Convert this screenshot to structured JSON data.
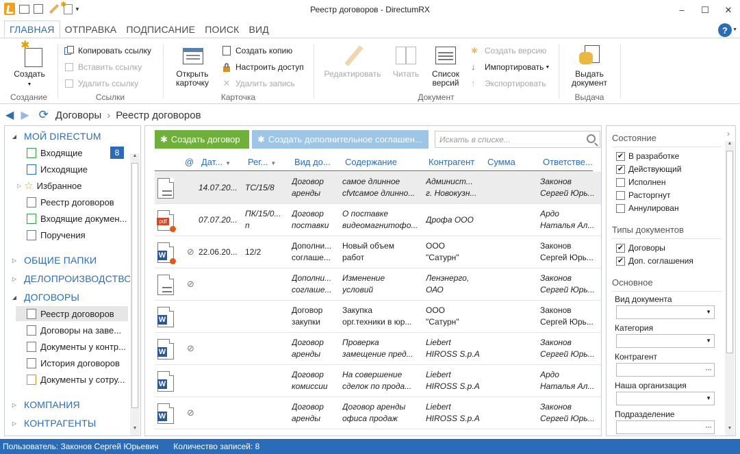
{
  "window": {
    "title": "Реестр договоров - DirectumRX",
    "controls": [
      "–",
      "☐",
      "✕"
    ]
  },
  "ribbon_tabs": [
    {
      "label": "ГЛАВНАЯ",
      "active": true
    },
    {
      "label": "ОТПРАВКА",
      "active": false
    },
    {
      "label": "ПОДПИСАНИЕ",
      "active": false
    },
    {
      "label": "ПОИСК",
      "active": false
    },
    {
      "label": "ВИД",
      "active": false
    }
  ],
  "ribbon": {
    "groups": {
      "create": "Создание",
      "links": "Ссылки",
      "card": "Карточка",
      "document": "Документ",
      "issue": "Выдача"
    },
    "create_button": "Создать",
    "copy_link": "Копировать ссылку",
    "paste_link": "Вставить ссылку",
    "delete_link": "Удалить ссылку",
    "open_card": "Открыть карточку",
    "create_copy": "Создать копию",
    "setup_access": "Настроить доступ",
    "delete_record": "Удалить запись",
    "edit": "Редактировать",
    "read": "Читать",
    "versions_list": "Список версий",
    "create_version": "Создать версию",
    "import": "Импортировать",
    "export": "Экспортировать",
    "issue_document": "Выдать документ"
  },
  "breadcrumb": [
    "Договоры",
    "Реестр договоров"
  ],
  "nav_tree": {
    "my_directum": "МОЙ DIRECTUM",
    "inbox": "Входящие",
    "inbox_count": "8",
    "outbox": "Исходящие",
    "favorites": "Избранное",
    "contracts_registry": "Реестр договоров",
    "incoming_docs": "Входящие докумен...",
    "assignments": "Поручения",
    "shared_folders": "ОБЩИЕ ПАПКИ",
    "records": "ДЕЛОПРОИЗВОДСТВО",
    "contracts": "ДОГОВОРЫ",
    "c_registry": "Реестр договоров",
    "c_approval": "Договоры на заве...",
    "c_control": "Документы у контр...",
    "c_history": "История договоров",
    "c_employees": "Документы у сотру...",
    "company": "КОМПАНИЯ",
    "counterparties": "КОНТРАГЕНТЫ"
  },
  "toolbar": {
    "create_contract": "Создать договор",
    "create_supplement": "Создать дополнительное соглашен...",
    "search_placeholder": "Искать в списке..."
  },
  "table": {
    "columns": [
      "@",
      "Дат...",
      "Рег...",
      "Вид до...",
      "Содержание",
      "Контрагент",
      "Сумма",
      "Ответстве..."
    ],
    "rows": [
      {
        "icon": "text",
        "clip": false,
        "date": "14.07.20...",
        "reg": "ТС/15/8",
        "kind1": "Договор",
        "kind2": "аренды",
        "content1": "самое длинное",
        "content2": "cfvtсамое длинно...",
        "cp1": "Админист...",
        "cp2": "г. Новокузн...",
        "amount": "",
        "resp1": "Законов",
        "resp2": "Сергей Юрь...",
        "italic": true,
        "selected": true
      },
      {
        "icon": "pdf",
        "clip": false,
        "date": "07.07.20...",
        "reg": "ПК/15/0...",
        "reg2": "n",
        "kind1": "Договор",
        "kind2": "поставки",
        "content1": "О поставке",
        "content2": "видеомагнитофо...",
        "cp1": "Дрофа ООО",
        "cp2": "",
        "amount": "",
        "resp1": "Ардо",
        "resp2": "Наталья Ал...",
        "italic": true,
        "selected": false
      },
      {
        "icon": "word-mark",
        "clip": true,
        "date": "22.06.20...",
        "reg": "12/2",
        "kind1": "Дополни...",
        "kind2": "соглаше...",
        "content1": "Новый объем",
        "content2": "работ",
        "cp1": "ООО",
        "cp2": "\"Сатурн\"",
        "amount": "",
        "resp1": "Законов",
        "resp2": "Сергей Юрь...",
        "italic": false,
        "selected": false
      },
      {
        "icon": "text",
        "clip": true,
        "date": "",
        "reg": "",
        "kind1": "Дополни...",
        "kind2": "соглаше...",
        "content1": "Изменение",
        "content2": "условий",
        "cp1": "Ленэнерго,",
        "cp2": "ОАО",
        "amount": "",
        "resp1": "Законов",
        "resp2": "Сергей Юрь...",
        "italic": true,
        "selected": false
      },
      {
        "icon": "word",
        "clip": false,
        "date": "",
        "reg": "",
        "kind1": "Договор",
        "kind2": "закупки",
        "content1": "Закупка",
        "content2": "орг.техники в юр...",
        "cp1": "ООО",
        "cp2": "\"Сатурн\"",
        "amount": "",
        "resp1": "Законов",
        "resp2": "Сергей Юрь...",
        "italic": false,
        "selected": false
      },
      {
        "icon": "word",
        "clip": true,
        "date": "",
        "reg": "",
        "kind1": "Договор",
        "kind2": "аренды",
        "content1": "Проверка",
        "content2": "замещение пред...",
        "cp1": "Liebert",
        "cp2": "HIROSS S.p.A",
        "amount": "",
        "resp1": "Законов",
        "resp2": "Сергей Юрь...",
        "italic": true,
        "selected": false
      },
      {
        "icon": "word",
        "clip": false,
        "date": "",
        "reg": "",
        "kind1": "Договор",
        "kind2": "комиссии",
        "content1": "На совершение",
        "content2": "сделок по прода...",
        "cp1": "Liebert",
        "cp2": "HIROSS S.p.A",
        "amount": "",
        "resp1": "Ардо",
        "resp2": "Наталья Ал...",
        "italic": true,
        "selected": false
      },
      {
        "icon": "word",
        "clip": true,
        "date": "",
        "reg": "",
        "kind1": "Договор",
        "kind2": "аренды",
        "content1": "Договор аренды",
        "content2": "офиса продаж",
        "cp1": "Liebert",
        "cp2": "HIROSS S.p.A",
        "amount": "",
        "resp1": "Законов",
        "resp2": "Сергей Юрь...",
        "italic": true,
        "selected": false
      }
    ]
  },
  "filter": {
    "state_title": "Состояние",
    "states": [
      {
        "label": "В разработке",
        "checked": true
      },
      {
        "label": "Действующий",
        "checked": true
      },
      {
        "label": "Исполнен",
        "checked": false
      },
      {
        "label": "Расторгнут",
        "checked": false
      },
      {
        "label": "Аннулирован",
        "checked": false
      }
    ],
    "types_title": "Типы документов",
    "types": [
      {
        "label": "Договоры",
        "checked": true
      },
      {
        "label": "Доп. соглашения",
        "checked": true
      }
    ],
    "main_title": "Основное",
    "fields": [
      {
        "label": "Вид документа",
        "kind": "dropdown"
      },
      {
        "label": "Категория",
        "kind": "dropdown"
      },
      {
        "label": "Контрагент",
        "kind": "lookup"
      },
      {
        "label": "Наша организация",
        "kind": "dropdown"
      },
      {
        "label": "Подразделение",
        "kind": "lookup"
      }
    ]
  },
  "status": {
    "user": "Пользователь: Законов Сергей Юрьевич",
    "count": "Количество записей: 8"
  }
}
